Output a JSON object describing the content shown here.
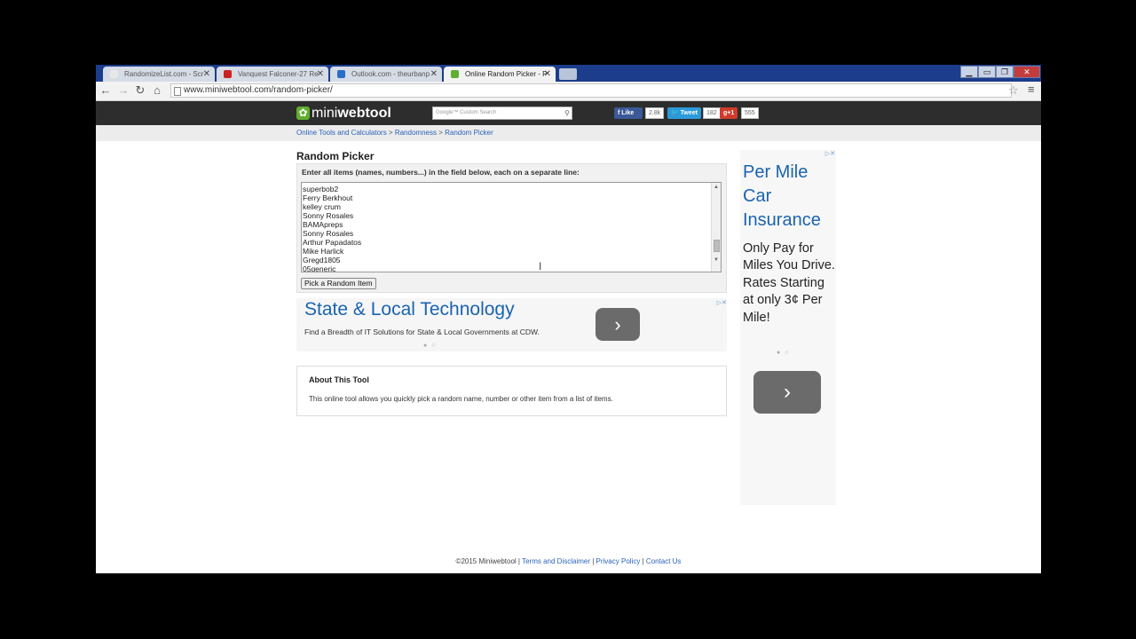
{
  "browser": {
    "tabs": [
      {
        "label": "RandomizeList.com - Scr",
        "favicon_color": "#e8e8e8"
      },
      {
        "label": "Vanquest Falconer-27 Re",
        "favicon_color": "#cc2222"
      },
      {
        "label": "Outlook.com - theurbanp",
        "favicon_color": "#2a6ec8"
      },
      {
        "label": "Online Random Picker - P",
        "favicon_color": "#5fae2e"
      }
    ],
    "url": "www.miniwebtool.com/random-picker/"
  },
  "site": {
    "logo_mini": "mini",
    "logo_web": "webtool",
    "search_placeholder": "Google™ Custom Search",
    "social": {
      "like_label": "Like",
      "like_count": "2.8k",
      "tweet_label": "Tweet",
      "tweet_count": "182",
      "gplus_label": "+1",
      "gplus_count": "555"
    }
  },
  "breadcrumb": {
    "items": [
      "Online Tools and Calculators",
      "Randomness",
      "Random Picker"
    ],
    "separator": ">"
  },
  "tool": {
    "title": "Random Picker",
    "instructions": "Enter all items (names, numbers...) in the field below, each on a separate line:",
    "items": [
      "superbob2",
      "Ferry Berkhout",
      "kelley crum",
      "Sonny Rosales",
      "BAMApreps",
      "Sonny Rosales",
      "Arthur Papadatos",
      "Mike Harlick",
      "Gregd1805",
      "05generic"
    ],
    "button": "Pick a Random Item"
  },
  "ad_banner": {
    "title": "State & Local Technology",
    "description": "Find a Breadth of IT Solutions for State & Local Governments at CDW."
  },
  "about": {
    "title": "About This Tool",
    "text": "This online tool allows you quickly pick a random name, number or other item from a list of items."
  },
  "ad_side": {
    "title": "Per Mile Car Insurance",
    "body": "Only Pay for Miles You Drive. Rates Starting at only 3¢ Per Mile!"
  },
  "footer": {
    "copyright": "©2015 Miniwebtool",
    "links": [
      "Terms and Disclaimer",
      "Privacy Policy",
      "Contact Us"
    ]
  }
}
